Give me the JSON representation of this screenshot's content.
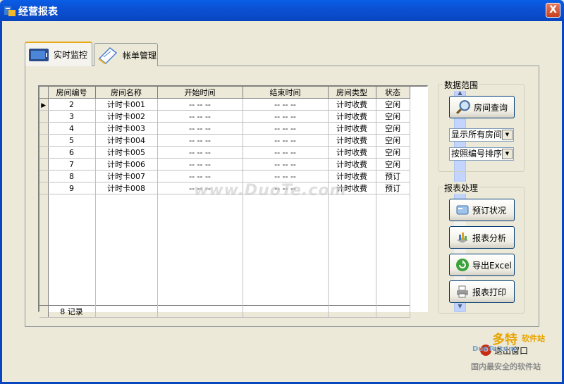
{
  "window": {
    "title": "经营报表",
    "close_label": "X"
  },
  "tabs": [
    {
      "label": "实时监控",
      "active": true
    },
    {
      "label": "帐单管理",
      "active": false
    }
  ],
  "grid": {
    "columns": [
      "房间编号",
      "房间名称",
      "开始时间",
      "结束时间",
      "房间类型",
      "状态"
    ],
    "rows": [
      [
        "2",
        "计时卡001",
        "-- -- --",
        "-- -- --",
        "计时收费",
        "空闲"
      ],
      [
        "3",
        "计时卡002",
        "-- -- --",
        "-- -- --",
        "计时收费",
        "空闲"
      ],
      [
        "4",
        "计时卡003",
        "-- -- --",
        "-- -- --",
        "计时收费",
        "空闲"
      ],
      [
        "5",
        "计时卡004",
        "-- -- --",
        "-- -- --",
        "计时收费",
        "空闲"
      ],
      [
        "6",
        "计时卡005",
        "-- -- --",
        "-- -- --",
        "计时收费",
        "空闲"
      ],
      [
        "7",
        "计时卡006",
        "-- -- --",
        "-- -- --",
        "计时收费",
        "空闲"
      ],
      [
        "8",
        "计时卡007",
        "-- -- --",
        "-- -- --",
        "计时收费",
        "预订"
      ],
      [
        "9",
        "计时卡008",
        "-- -- --",
        "-- -- --",
        "计时收费",
        "预订"
      ]
    ],
    "footer": "8 记录"
  },
  "data_range": {
    "title": "数据范围",
    "query_button": "房间查询",
    "filter_select": "显示所有房间",
    "sort_select": "按照编号排序"
  },
  "report": {
    "title": "报表处理",
    "buttons": [
      "预订状况",
      "报表分析",
      "导出Excel",
      "报表打印"
    ]
  },
  "exit_label": "退出窗口",
  "watermarks": {
    "center": "www.DuoTe.com",
    "logo_big": "多特",
    "logo_tag": "软件站",
    "logo_url": "DuoTe.com",
    "logo_slogan": "国内最安全的软件站"
  },
  "colors": {
    "titlebar": "#0a5ee6",
    "face": "#ece9d8",
    "accent": "#e6a817"
  }
}
